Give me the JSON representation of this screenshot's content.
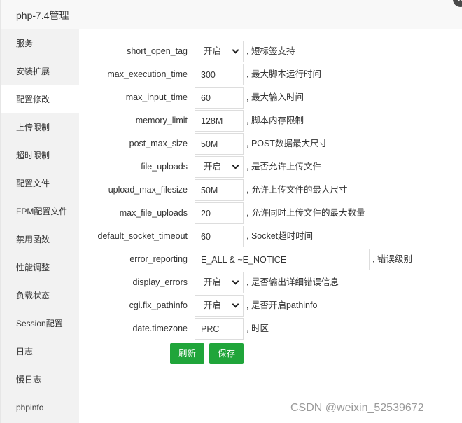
{
  "window": {
    "title": "php-7.4管理",
    "close_symbol": "✕"
  },
  "sidebar": {
    "items": [
      {
        "label": "服务"
      },
      {
        "label": "安装扩展"
      },
      {
        "label": "配置修改"
      },
      {
        "label": "上传限制"
      },
      {
        "label": "超时限制"
      },
      {
        "label": "配置文件"
      },
      {
        "label": "FPM配置文件"
      },
      {
        "label": "禁用函数"
      },
      {
        "label": "性能调整"
      },
      {
        "label": "负载状态"
      },
      {
        "label": "Session配置"
      },
      {
        "label": "日志"
      },
      {
        "label": "慢日志"
      },
      {
        "label": "phpinfo"
      }
    ],
    "active_index": 2
  },
  "config": {
    "rows": [
      {
        "name": "short_open_tag",
        "value": "开启",
        "desc": ", 短标签支持"
      },
      {
        "name": "max_execution_time",
        "value": "300",
        "desc": ", 最大脚本运行时间"
      },
      {
        "name": "max_input_time",
        "value": "60",
        "desc": ", 最大输入时间"
      },
      {
        "name": "memory_limit",
        "value": "128M",
        "desc": ", 脚本内存限制"
      },
      {
        "name": "post_max_size",
        "value": "50M",
        "desc": ", POST数据最大尺寸"
      },
      {
        "name": "file_uploads",
        "value": "开启",
        "desc": ", 是否允许上传文件"
      },
      {
        "name": "upload_max_filesize",
        "value": "50M",
        "desc": ", 允许上传文件的最大尺寸"
      },
      {
        "name": "max_file_uploads",
        "value": "20",
        "desc": ", 允许同时上传文件的最大数量"
      },
      {
        "name": "default_socket_timeout",
        "value": "60",
        "desc": ", Socket超时时间"
      },
      {
        "name": "error_reporting",
        "value": "E_ALL & ~E_NOTICE",
        "desc": ", 错误级别"
      },
      {
        "name": "display_errors",
        "value": "开启",
        "desc": ", 是否输出详细错误信息"
      },
      {
        "name": "cgi.fix_pathinfo",
        "value": "开启",
        "desc": ", 是否开启pathinfo"
      },
      {
        "name": "date.timezone",
        "value": "PRC",
        "desc": ", 时区"
      }
    ]
  },
  "buttons": {
    "refresh": "刷新",
    "save": "保存"
  },
  "colors": {
    "accent": "#20a53a",
    "sidebar_bg": "#f2f2f2",
    "titlebar_bg": "#f8f8f8"
  },
  "watermark": "CSDN @weixin_52539672"
}
